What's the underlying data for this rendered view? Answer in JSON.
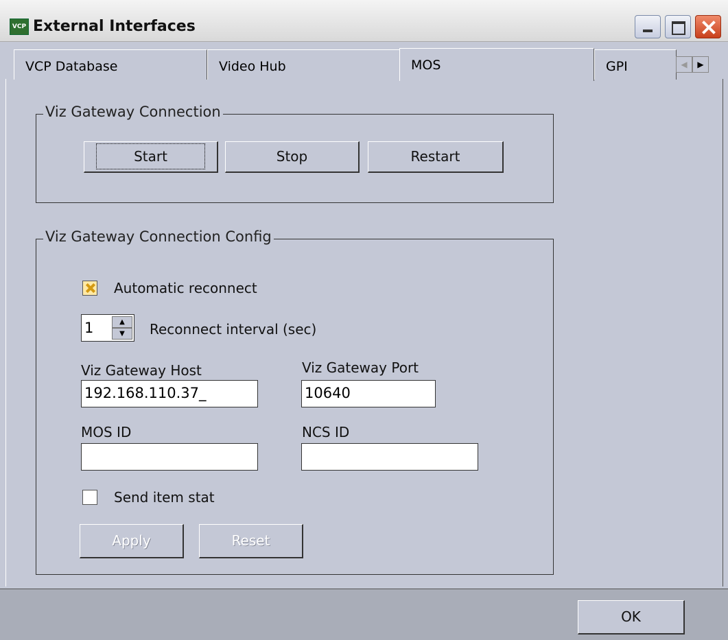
{
  "window": {
    "title": "External Interfaces",
    "icon_text": "VCP"
  },
  "tabs": [
    {
      "label": "VCP Database"
    },
    {
      "label": "Video Hub"
    },
    {
      "label": "MOS"
    },
    {
      "label": "GPI"
    }
  ],
  "tab_scroll": {
    "left": "◀",
    "right": "▶"
  },
  "connection": {
    "legend": "Viz Gateway Connection",
    "start": "Start",
    "stop": "Stop",
    "restart": "Restart"
  },
  "config": {
    "legend": "Viz Gateway Connection Config",
    "auto_reconnect_label": "Automatic reconnect",
    "auto_reconnect_checked": true,
    "interval_value": "1",
    "interval_label": "Reconnect interval (sec)",
    "host_label": "Viz Gateway Host",
    "host_value": "192.168.110.37_",
    "port_label": "Viz Gateway Port",
    "port_value": "10640",
    "mos_id_label": "MOS ID",
    "mos_id_value": "",
    "ncs_id_label": "NCS ID",
    "ncs_id_value": "",
    "send_item_stat_label": "Send item stat",
    "send_item_stat_checked": false,
    "apply": "Apply",
    "reset": "Reset"
  },
  "footer": {
    "ok": "OK"
  }
}
